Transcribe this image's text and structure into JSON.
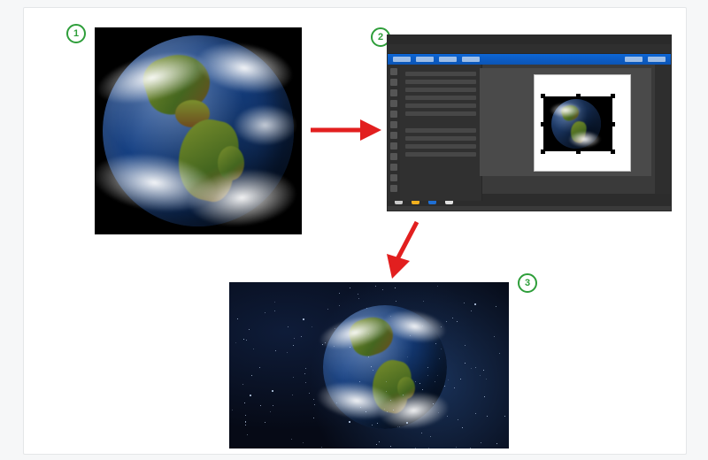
{
  "steps": {
    "s1": {
      "label": "1"
    },
    "s2": {
      "label": "2"
    },
    "s3": {
      "label": "3"
    }
  },
  "status_swatches": [
    "#c9c9c9",
    "#f2b01e",
    "#1f6fd4",
    "#e0e0e0"
  ]
}
